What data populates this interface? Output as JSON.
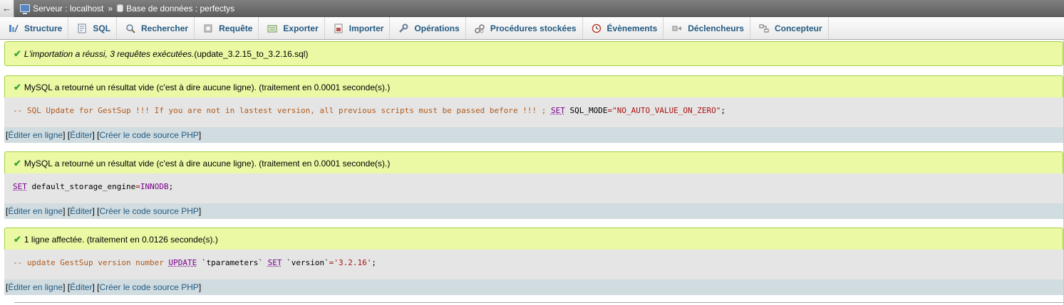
{
  "breadcrumb": {
    "back": "←",
    "server_label": "Serveur : localhost",
    "separator": "»",
    "database_label": "Base de données : perfectys"
  },
  "tabs": [
    {
      "label": "Structure",
      "icon": "structure-icon"
    },
    {
      "label": "SQL",
      "icon": "sql-icon"
    },
    {
      "label": "Rechercher",
      "icon": "search-icon"
    },
    {
      "label": "Requête",
      "icon": "query-icon"
    },
    {
      "label": "Exporter",
      "icon": "export-icon"
    },
    {
      "label": "Importer",
      "icon": "import-icon"
    },
    {
      "label": "Opérations",
      "icon": "wrench-icon"
    },
    {
      "label": "Procédures stockées",
      "icon": "routines-icon"
    },
    {
      "label": "Évènements",
      "icon": "clock-icon"
    },
    {
      "label": "Déclencheurs",
      "icon": "triggers-icon"
    },
    {
      "label": "Concepteur",
      "icon": "designer-icon"
    }
  ],
  "import_message": {
    "italic": "L'importation a réussi, 3 requêtes exécutées.",
    "file": " (update_3.2.15_to_3.2.16.sql)"
  },
  "results": [
    {
      "message": "MySQL a retourné un résultat vide (c'est à dire aucune ligne). (traitement en 0.0001 seconde(s).)",
      "sql": {
        "comment": "-- SQL Update for GestSup !!! If you are not in lastest version, all previous scripts must be passed before !!! ;",
        "kw1": "SET",
        "ident": "SQL_MODE",
        "op": "=",
        "str": "\"NO_AUTO_VALUE_ON_ZERO\"",
        "end": ";"
      }
    },
    {
      "message": "MySQL a retourné un résultat vide (c'est à dire aucune ligne). (traitement en 0.0001 seconde(s).)",
      "sql": {
        "kw1": "SET",
        "ident": "default_storage_engine",
        "op": "=",
        "kw2": "INNODB",
        "end": ";"
      }
    },
    {
      "message": "1 ligne affectée. (traitement en 0.0126 seconde(s).)",
      "sql": {
        "comment": "-- update GestSup version number",
        "kw1": "UPDATE",
        "table": "`tparameters`",
        "kw2": "SET",
        "col": "`version`",
        "op": "=",
        "str": "'3.2.16'",
        "end": ";"
      }
    }
  ],
  "tools": {
    "open": "[",
    "close": "]",
    "edit_inline": "Éditer en ligne",
    "edit": "Éditer",
    "php_code": "Créer le code source PHP"
  },
  "colors": {
    "success_bg": "#ebf8a4",
    "success_border": "#a2d246",
    "link": "#235a81",
    "sql_bg": "#e5e5e5",
    "tool_bg": "#d0dce0"
  }
}
